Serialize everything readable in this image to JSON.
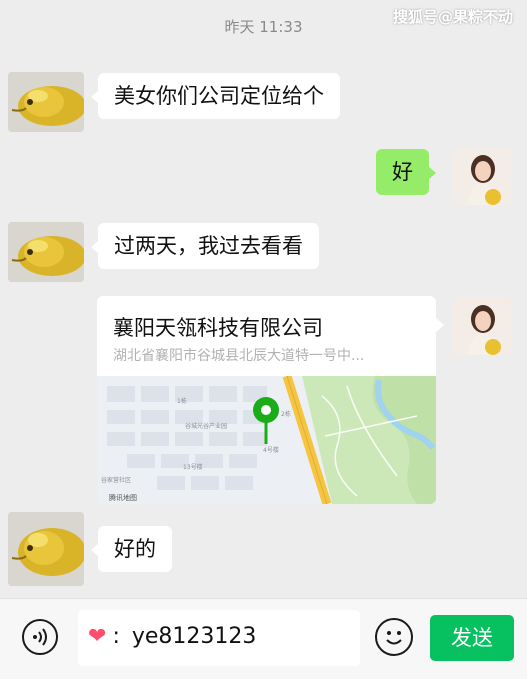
{
  "header": {
    "timestamp": "昨天 11:33",
    "watermark": "搜狐号@果粽不动"
  },
  "messages": [
    {
      "side": "left",
      "text": "美女你们公司定位给个"
    },
    {
      "side": "right",
      "text": "好"
    },
    {
      "side": "left",
      "text": "过两天，我过去看看"
    },
    {
      "side": "right",
      "type": "location",
      "title": "襄阳天瓴科技有限公司",
      "address": "湖北省襄阳市谷城县北辰大道特一号中..."
    },
    {
      "side": "left",
      "text": "好的"
    }
  ],
  "map": {
    "labels": [
      "1栋",
      "谷城光谷产业园",
      "13号楼",
      "4号楼",
      "谷家营社区",
      "腾讯地图",
      "2栋"
    ],
    "pin_color": "#1aad19",
    "road_color": "#f5c542",
    "park_color": "#cde8b8",
    "water_color": "#9fd3f0"
  },
  "input_bar": {
    "input_value": "ye8123123",
    "send_label": "发送"
  },
  "colors": {
    "background": "#ededed",
    "self_bubble": "#95ec69",
    "send_button": "#07c160"
  }
}
